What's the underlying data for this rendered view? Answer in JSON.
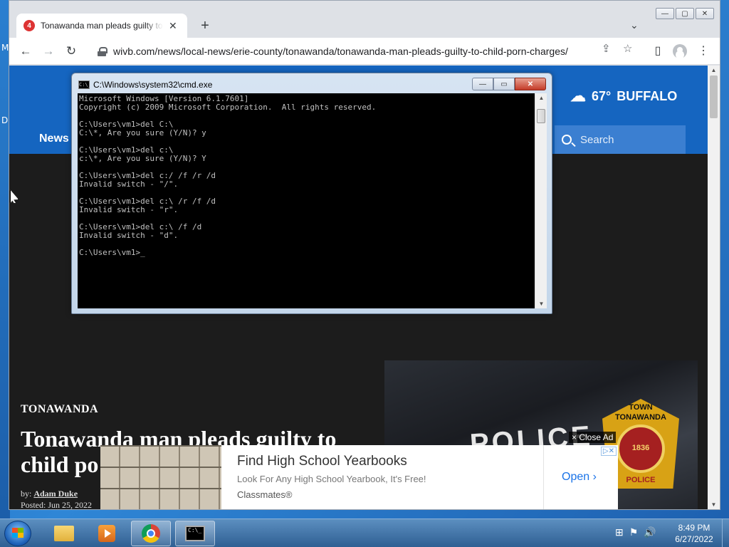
{
  "desktop": {
    "edge_labels": [
      "M",
      "D"
    ]
  },
  "browser": {
    "tab": {
      "title": "Tonawanda man pleads guilty to child porn charges",
      "close_glyph": "✕"
    },
    "new_tab_glyph": "+",
    "tab_search_glyph": "⌄",
    "window_controls": {
      "minimize": "—",
      "maximize": "▢",
      "close": "✕"
    },
    "toolbar": {
      "back": "←",
      "forward": "→",
      "reload": "↻",
      "url": "wivb.com/news/local-news/erie-county/tonawanda/tonawanda-man-pleads-guilty-to-child-porn-charges/",
      "share_glyph": "⇪",
      "bookmark_glyph": "☆",
      "sidepanel_glyph": "▯",
      "menu_glyph": "⋮"
    }
  },
  "page": {
    "weather": {
      "temp": "67°",
      "city": "BUFFALO",
      "icon": "sun-cloud-icon"
    },
    "nav_news": "News",
    "search_placeholder": "Search",
    "section_tag": "TONAWANDA",
    "headline": "Tonawanda man pleads guilty to child po",
    "byline_prefix": "by:",
    "author": "Adam Duke",
    "posted": "Posted: Jun 25, 2022",
    "image": {
      "vest_text": "POLICE",
      "badge_top": "TOWN",
      "badge_name": "TONAWANDA",
      "badge_year": "1836",
      "badge_bottom": "POLICE"
    },
    "close_ad": "× Close Ad",
    "ad": {
      "title": "Find High School Yearbooks",
      "subtitle": "Look For Any High School Yearbook, It's Free!",
      "brand": "Classmates®",
      "cta": "Open",
      "cta_glyph": "›",
      "marks": "▷✕"
    }
  },
  "cmd": {
    "title": "C:\\Windows\\system32\\cmd.exe",
    "icon_text": "C:\\_",
    "buttons": {
      "minimize": "—",
      "maximize": "▭",
      "close": "✕"
    },
    "lines": [
      "Microsoft Windows [Version 6.1.7601]",
      "Copyright (c) 2009 Microsoft Corporation.  All rights reserved.",
      "",
      "C:\\Users\\vm1>del C:\\",
      "C:\\*, Are you sure (Y/N)? y",
      "",
      "C:\\Users\\vm1>del c:\\",
      "c:\\*, Are you sure (Y/N)? Y",
      "",
      "C:\\Users\\vm1>del c:/ /f /r /d",
      "Invalid switch - \"/\".",
      "",
      "C:\\Users\\vm1>del c:\\ /r /f /d",
      "Invalid switch - \"r\".",
      "",
      "C:\\Users\\vm1>del c:\\ /f /d",
      "Invalid switch - \"d\".",
      "",
      "C:\\Users\\vm1>_"
    ]
  },
  "taskbar": {
    "cmd_icon_text": "C:\\_",
    "clock_time": "8:49 PM",
    "clock_date": "6/27/2022",
    "tray_glyphs": [
      "⊞",
      "⚑",
      "🔊"
    ]
  }
}
